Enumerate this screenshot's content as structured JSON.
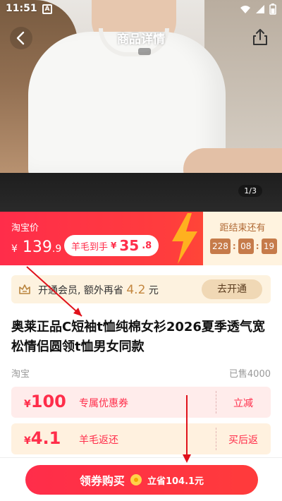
{
  "status_bar": {
    "time": "11:51",
    "a_badge": "A"
  },
  "nav": {
    "title": "商品详情"
  },
  "gallery": {
    "pager": "1/3"
  },
  "price": {
    "label": "淘宝价",
    "currency": "¥",
    "integer": "139",
    "decimal": ".9",
    "promo_label": "羊毛到手",
    "promo_currency": "¥",
    "promo_integer": "35",
    "promo_decimal": ".8"
  },
  "countdown": {
    "label": "距结束还有",
    "h": "228",
    "m": "08",
    "s": "19"
  },
  "vip": {
    "text": "开通会员, 额外再省",
    "amount": "4.2",
    "unit": "元",
    "button": "去开通"
  },
  "product": {
    "title": "奥莱正品C短袖t恤纯棉女衫2026夏季透气宽松情侣圆领t恤男女同款",
    "shop": "淘宝",
    "sold": "已售4000"
  },
  "coupons": [
    {
      "currency": "¥",
      "amount": "100",
      "name": "专属优惠券",
      "action": "立减"
    },
    {
      "currency": "¥",
      "amount": "4.1",
      "name": "羊毛返还",
      "action": "买后返"
    }
  ],
  "bottom": {
    "buy_label": "领券购买",
    "save_label": "立省104.1元"
  },
  "colors": {
    "accent": "#ff2d4a",
    "gold": "#c3863e",
    "countdown": "#c67b4a"
  }
}
